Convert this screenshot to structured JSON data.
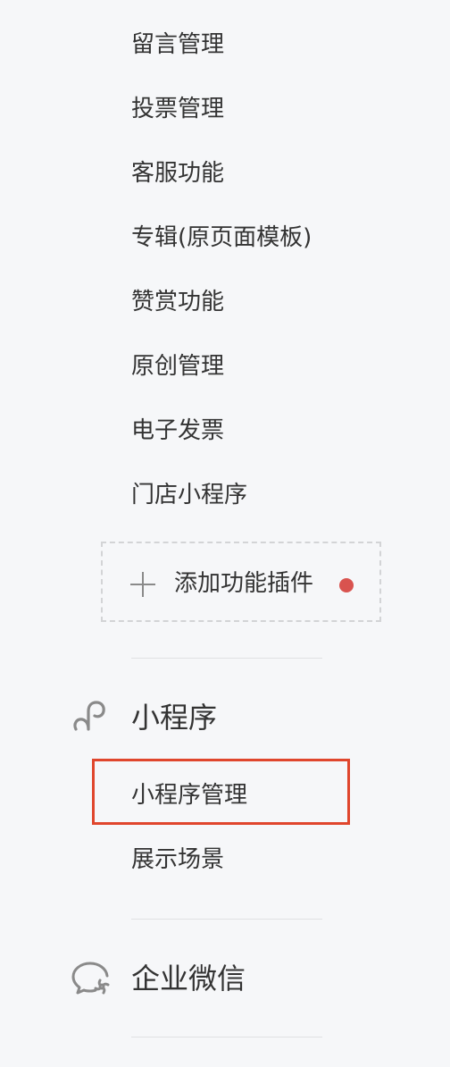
{
  "menu": {
    "items": [
      {
        "label": "留言管理"
      },
      {
        "label": "投票管理"
      },
      {
        "label": "客服功能"
      },
      {
        "label": "专辑(原页面模板)"
      },
      {
        "label": "赞赏功能"
      },
      {
        "label": "原创管理"
      },
      {
        "label": "电子发票"
      },
      {
        "label": "门店小程序"
      }
    ],
    "add_plugin": {
      "label": "添加功能插件",
      "icon": "plus-icon",
      "dot_color": "#d9534f"
    }
  },
  "miniprogram": {
    "title": "小程序",
    "icon": "miniprogram-icon",
    "items": [
      {
        "label": "小程序管理"
      },
      {
        "label": "展示场景"
      }
    ]
  },
  "work_wechat": {
    "title": "企业微信",
    "icon": "work-wechat-icon"
  },
  "colors": {
    "highlight": "#e0462d",
    "text": "#333333",
    "icon": "#8a8a8a",
    "background": "#f6f7f9"
  }
}
